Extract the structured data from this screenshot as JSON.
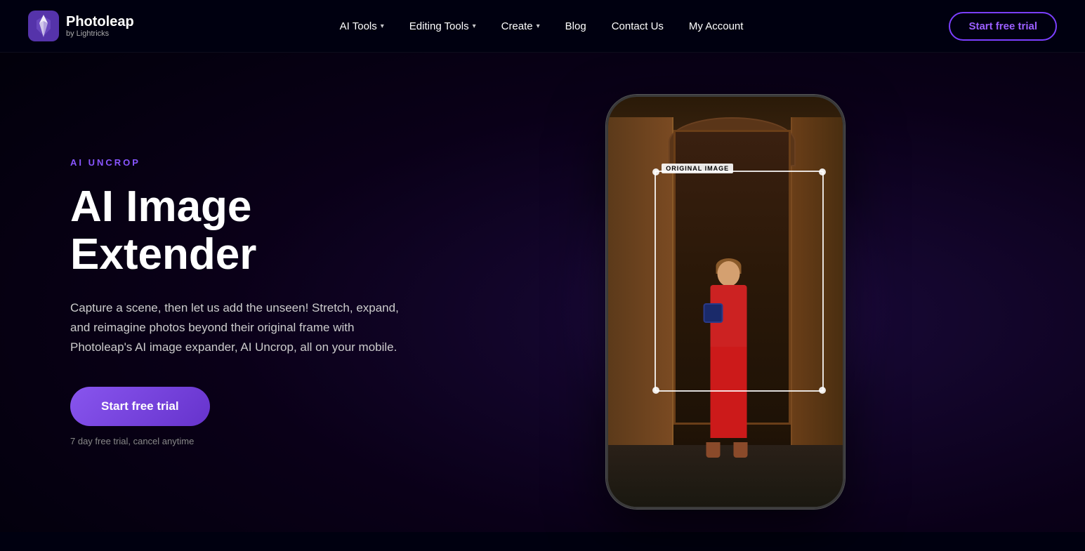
{
  "brand": {
    "name": "Photoleap",
    "subtitle": "by Lightricks"
  },
  "nav": {
    "links": [
      {
        "id": "ai-tools",
        "label": "AI Tools",
        "hasDropdown": true
      },
      {
        "id": "editing-tools",
        "label": "Editing Tools",
        "hasDropdown": true
      },
      {
        "id": "create",
        "label": "Create",
        "hasDropdown": true
      },
      {
        "id": "blog",
        "label": "Blog",
        "hasDropdown": false
      },
      {
        "id": "contact-us",
        "label": "Contact Us",
        "hasDropdown": false
      },
      {
        "id": "my-account",
        "label": "My Account",
        "hasDropdown": false
      }
    ],
    "cta_label": "Start free trial"
  },
  "hero": {
    "eyebrow": "AI UNCROP",
    "title": "AI Image Extender",
    "description": "Capture a scene, then let us add the unseen! Stretch, expand, and reimagine photos beyond their original frame with Photoleap's AI image expander, AI Uncrop, all on your mobile.",
    "cta_label": "Start free trial",
    "trial_note": "7 day free trial, cancel anytime"
  },
  "phone_mockup": {
    "original_image_label": "ORIGINAL IMAGE"
  },
  "colors": {
    "accent": "#8855ee",
    "accent_border": "#7b3fff",
    "eyebrow": "#8855ff"
  }
}
